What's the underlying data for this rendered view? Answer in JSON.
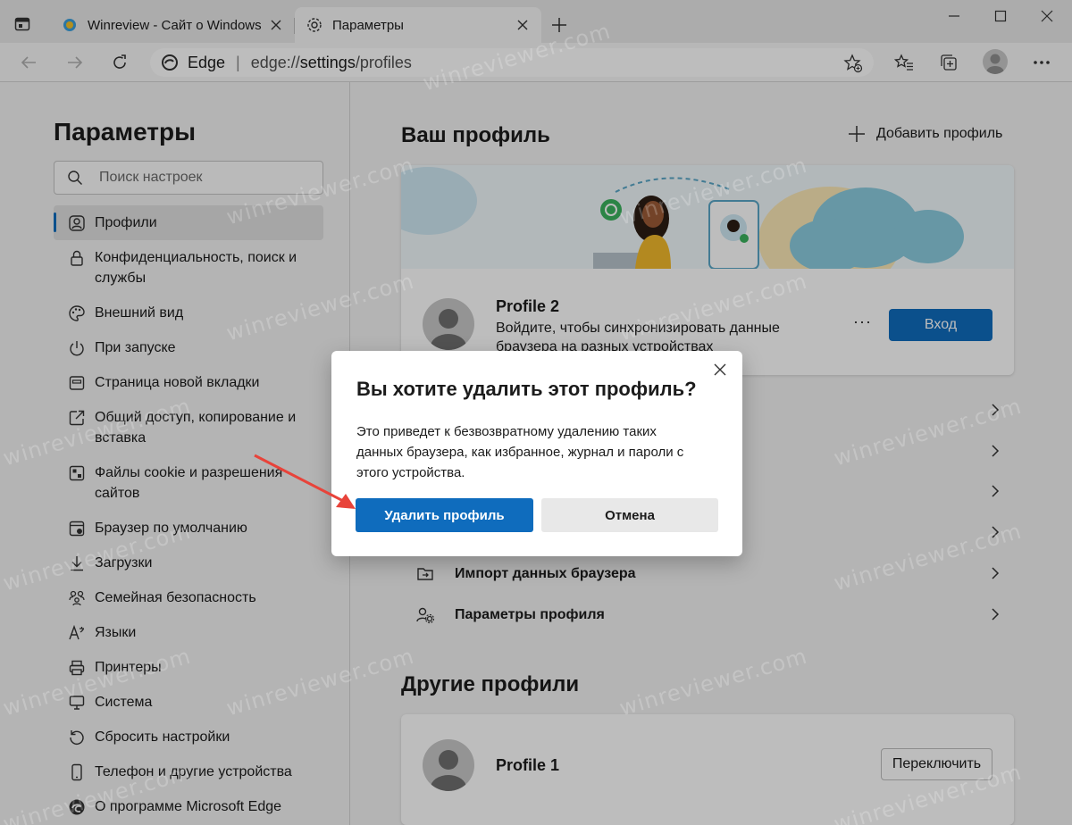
{
  "browser": {
    "tabs": [
      {
        "title": "Winreview - Сайт о Windows",
        "active": false
      },
      {
        "title": "Параметры",
        "active": true
      }
    ],
    "address": {
      "brand": "Edge",
      "separator": "|",
      "url_prefix": "edge://",
      "url_highlight": "settings",
      "url_suffix": "/profiles"
    }
  },
  "sidebar": {
    "title": "Параметры",
    "search_placeholder": "Поиск настроек",
    "items": [
      {
        "label": "Профили",
        "icon": "profile-icon",
        "active": true
      },
      {
        "label": "Конфиденциальность, поиск и службы",
        "icon": "lock-icon"
      },
      {
        "label": "Внешний вид",
        "icon": "palette-icon"
      },
      {
        "label": "При запуске",
        "icon": "power-icon"
      },
      {
        "label": "Страница новой вкладки",
        "icon": "newtab-page-icon"
      },
      {
        "label": "Общий доступ, копирование и вставка",
        "icon": "share-icon"
      },
      {
        "label": "Файлы cookie и разрешения сайтов",
        "icon": "cookie-icon"
      },
      {
        "label": "Браузер по умолчанию",
        "icon": "default-browser-icon"
      },
      {
        "label": "Загрузки",
        "icon": "download-icon"
      },
      {
        "label": "Семейная безопасность",
        "icon": "family-icon"
      },
      {
        "label": "Языки",
        "icon": "language-icon"
      },
      {
        "label": "Принтеры",
        "icon": "printer-icon"
      },
      {
        "label": "Система",
        "icon": "system-icon"
      },
      {
        "label": "Сбросить настройки",
        "icon": "reset-icon"
      },
      {
        "label": "Телефон и другие устройства",
        "icon": "phone-icon"
      },
      {
        "label": "О программе Microsoft Edge",
        "icon": "edge-logo-icon"
      }
    ]
  },
  "main": {
    "your_profile_heading": "Ваш профиль",
    "add_profile_label": "Добавить профиль",
    "current_profile": {
      "name": "Profile 2",
      "desc_line1": "Войдите, чтобы синхронизировать данные",
      "desc_line2": "браузера на разных устройствах",
      "more_label": "···",
      "signin_label": "Вход"
    },
    "rows": [
      {
        "label": "Импорт данных браузера",
        "icon": "import-icon"
      },
      {
        "label": "Параметры профиля",
        "icon": "profile-settings-icon"
      }
    ],
    "other_profiles_heading": "Другие профили",
    "other_profile": {
      "name": "Profile 1",
      "switch_label": "Переключить"
    }
  },
  "dialog": {
    "title": "Вы хотите удалить этот профиль?",
    "body_line1": "Это приведет к безвозвратному удалению таких",
    "body_line2": "данных браузера, как избранное, журнал и пароли с",
    "body_line3": "этого устройства.",
    "primary_label": "Удалить профиль",
    "secondary_label": "Отмена"
  },
  "watermark": "winreviewer.com",
  "colors": {
    "accent": "#0f6cbd",
    "annotation_arrow": "#e8433a"
  }
}
